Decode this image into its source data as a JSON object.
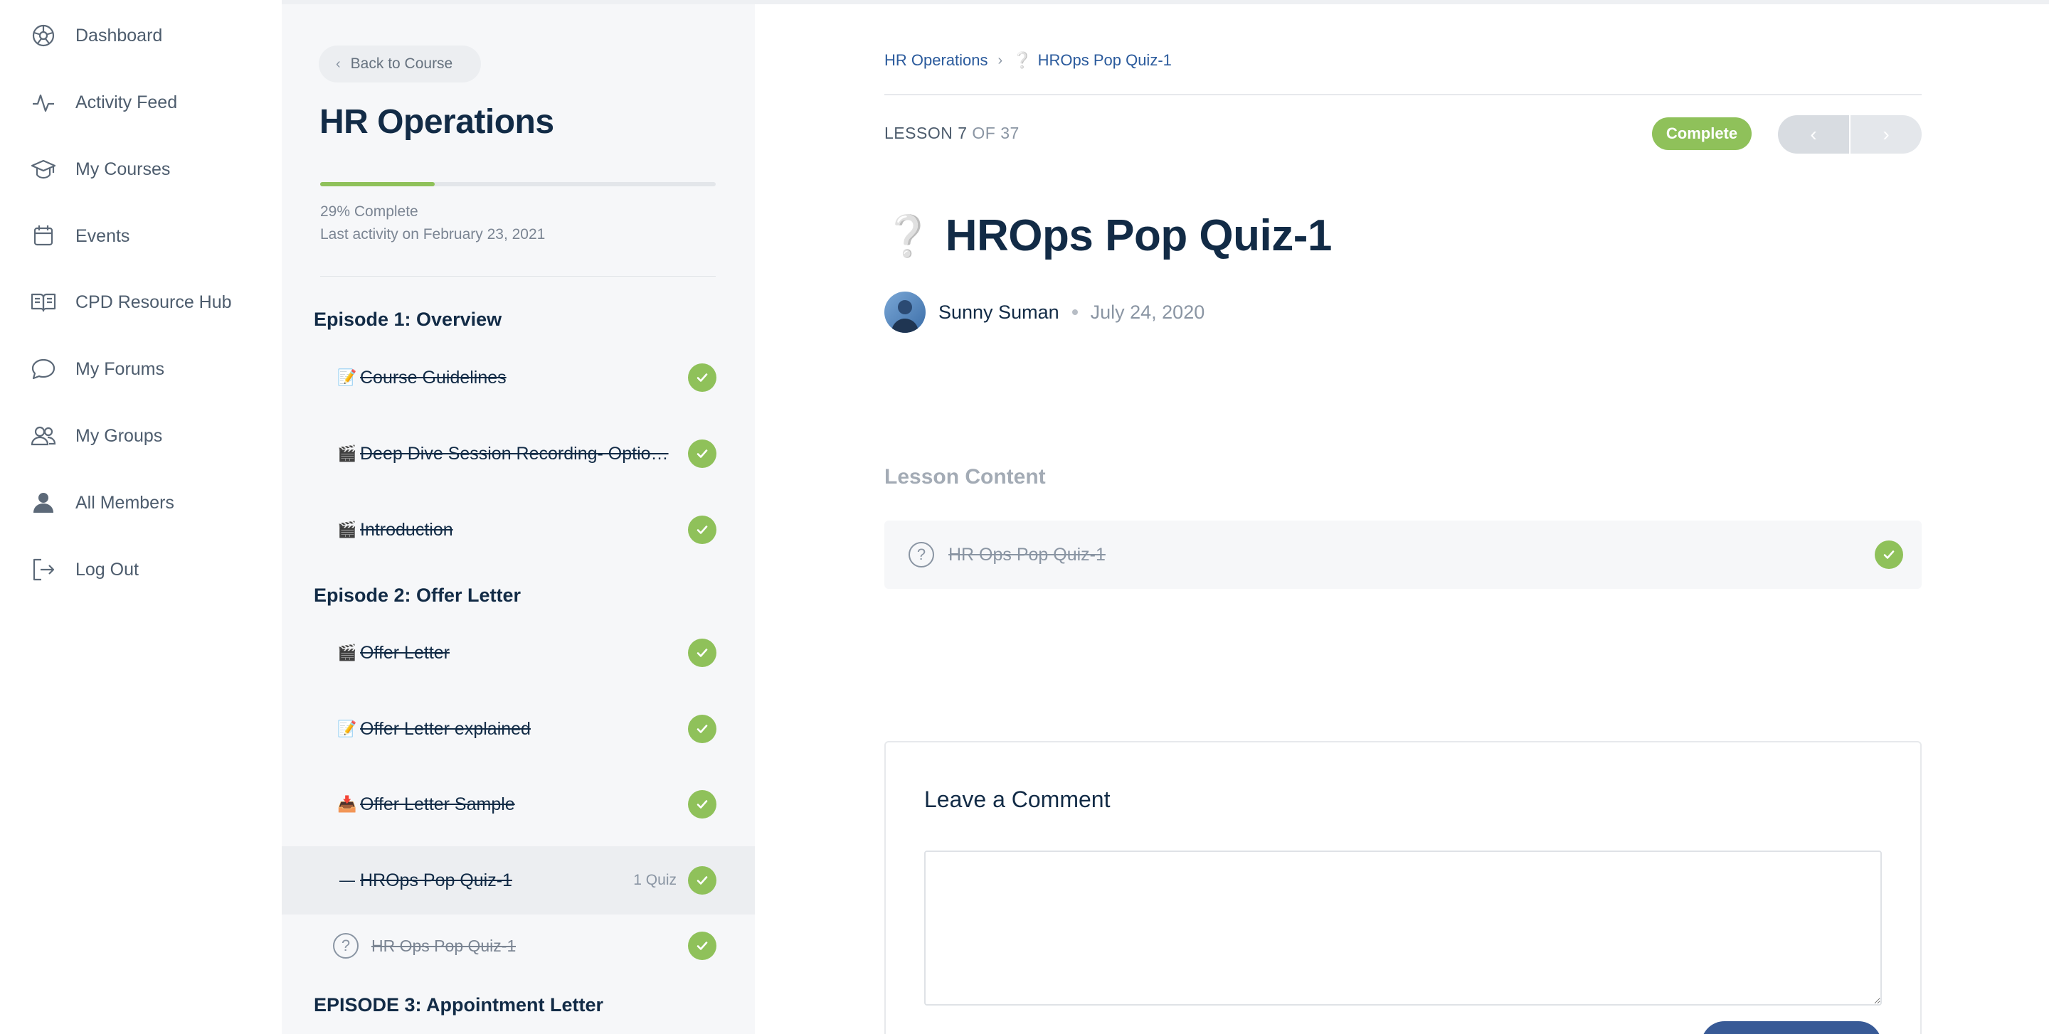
{
  "nav": {
    "items": [
      {
        "label": "Dashboard",
        "icon": "dashboard-icon"
      },
      {
        "label": "Activity Feed",
        "icon": "activity-icon"
      },
      {
        "label": "My Courses",
        "icon": "graduation-cap-icon"
      },
      {
        "label": "Events",
        "icon": "calendar-icon"
      },
      {
        "label": "CPD Resource Hub",
        "icon": "book-open-icon"
      },
      {
        "label": "My Forums",
        "icon": "chat-bubble-icon"
      },
      {
        "label": "My Groups",
        "icon": "group-icon"
      },
      {
        "label": "All Members",
        "icon": "user-icon"
      },
      {
        "label": "Log Out",
        "icon": "logout-icon"
      }
    ]
  },
  "course": {
    "back_label": "Back to Course",
    "title": "HR Operations",
    "progress_percent": 29,
    "progress_text": "29% Complete",
    "last_activity": "Last activity on February 23, 2021",
    "episodes": [
      {
        "title": "Episode 1: Overview",
        "lessons": [
          {
            "emoji": "📝",
            "title": "Course Guidelines"
          },
          {
            "emoji": "🎬",
            "title": "Deep Dive Session Recording- Optio…"
          },
          {
            "emoji": "🎬",
            "title": "Introduction"
          }
        ]
      },
      {
        "title": "Episode 2: Offer Letter",
        "lessons": [
          {
            "emoji": "🎬",
            "title": "Offer Letter"
          },
          {
            "emoji": "📝",
            "title": "Offer Letter explained"
          },
          {
            "emoji": "📥",
            "title": "Offer Letter Sample"
          },
          {
            "emoji": "—",
            "title": "HROps Pop Quiz-1",
            "count": "1 Quiz"
          },
          {
            "emoji": "?",
            "title": "HR Ops Pop Quiz-1"
          }
        ]
      },
      {
        "title": "EPISODE 3: Appointment Letter",
        "lessons": []
      }
    ]
  },
  "main": {
    "breadcrumb": {
      "course": "HR Operations",
      "separator": "›",
      "current": "HROps Pop Quiz-1"
    },
    "lesson_label": "LESSON 7",
    "lesson_of": "OF 37",
    "complete_label": "Complete",
    "prev_label": "‹",
    "next_label": "›",
    "quiz_title": "HROps Pop Quiz-1",
    "author": "Sunny Suman",
    "date": "July 24, 2020",
    "lesson_content_title": "Lesson Content",
    "lesson_content_item": "HR Ops Pop Quiz-1",
    "comment_title": "Leave a Comment"
  },
  "colors": {
    "accent_green": "#8fc15a",
    "text_dark": "#122b46",
    "link_blue": "#2a5a9c",
    "button_blue": "#385a96"
  }
}
